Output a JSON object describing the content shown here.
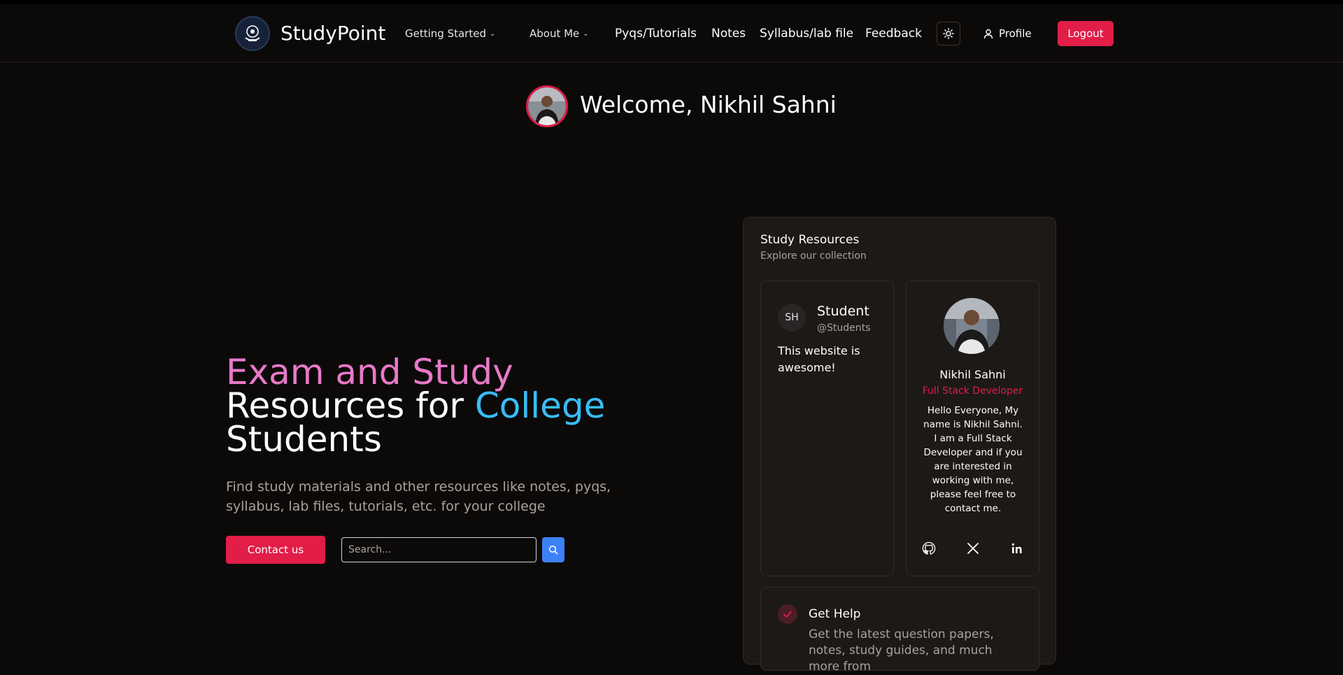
{
  "header": {
    "brand": "StudyPoint",
    "nav": {
      "getting_started": "Getting Started",
      "about_me": "About Me",
      "pyqs": "Pyqs/Tutorials",
      "notes": "Notes",
      "syllabus": "Syllabus/lab file",
      "feedback": "Feedback"
    },
    "profile": "Profile",
    "logout": "Logout"
  },
  "welcome": {
    "text": "Welcome, Nikhil Sahni"
  },
  "hero": {
    "title_part1": "Exam and Study",
    "title_part2": "Resources for ",
    "title_part3": "College",
    "title_part4": "Students",
    "subtitle": "Find study materials and other resources like notes, pyqs, syllabus, lab files, tutorials, etc. for your college",
    "contact_button": "Contact us",
    "search_placeholder": "Search..."
  },
  "resources": {
    "title": "Study Resources",
    "subtitle": "Explore our collection",
    "student_card": {
      "initials": "SH",
      "name": "Student",
      "handle": "@Students",
      "quote": "This website is awesome!"
    },
    "profile_card": {
      "name": "Nikhil Sahni",
      "role": "Full Stack Developer",
      "bio": "Hello Everyone, My name is Nikhil Sahni. I am a Full Stack Developer and if you are interested in working with me, please feel free to contact me.",
      "socials": [
        "github-icon",
        "x-icon",
        "linkedin-icon"
      ]
    },
    "help_card": {
      "title": "Get Help",
      "text": "Get the latest question papers, notes, study guides, and much more from"
    }
  },
  "colors": {
    "accent": "#e11d48",
    "search_button": "#3b82f6",
    "title_pink": "#e879c9",
    "title_blue": "#38bdf8",
    "background": "#0c0a09",
    "panel": "#1c1917"
  }
}
